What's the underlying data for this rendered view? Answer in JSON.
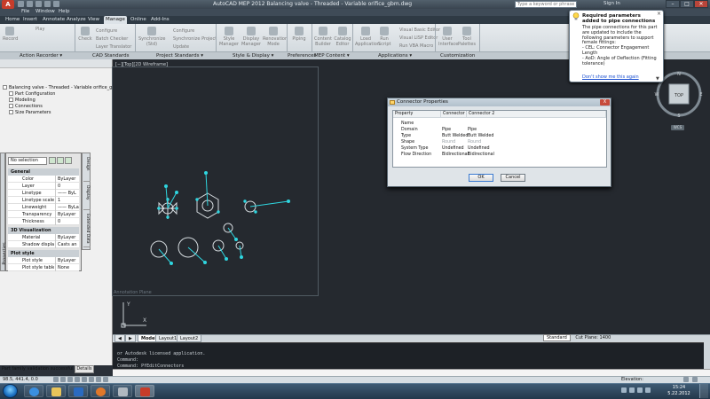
{
  "window": {
    "title": "AutoCAD MEP 2012   Balancing valve - Threaded - Variable orifice_gbm.dwg",
    "search_placeholder": "Type a keyword or phrase",
    "sign_in": "Sign In"
  },
  "menubar": [
    "File",
    "Window",
    "Help"
  ],
  "ribbon_tabs": [
    "Home",
    "Insert",
    "Annotate",
    "Analyze",
    "View",
    "Manage",
    "Online",
    "Add-Ins"
  ],
  "ribbon": {
    "buttons": [
      "Record",
      "Play",
      "Check",
      "Configure",
      "Batch Checker",
      "Layer Translator",
      "Synchronize (Std)",
      "Configure",
      "Synchronize Project",
      "Update",
      "Style Manager",
      "Display Manager",
      "Renovation Mode",
      "Piping",
      "Content Builder",
      "Catalog Editor",
      "Load Application",
      "Run Script",
      "Visual Basic Editor",
      "Visual LISP Editor",
      "Run VBA Macro",
      "User Interface",
      "Tool Palettes"
    ],
    "panels": [
      "Action Recorder ▾",
      "CAD Standards",
      "Project Standards ▾",
      "Style & Display ▾",
      "Preferences",
      "MEP Content ▾",
      "Applications ▾",
      "Customization"
    ]
  },
  "tree": {
    "root": "Balancing valve - Threaded - Variable orifice_gbm",
    "items": [
      "Part Configuration",
      "Modeling",
      "Connections",
      "Size Parameters"
    ]
  },
  "properties": {
    "selection": "No selection",
    "side_label": "Properties",
    "vtabs": [
      "Design",
      "Display",
      "Extended Data"
    ],
    "sections": [
      {
        "title": "General",
        "rows": [
          {
            "key": "Color",
            "value": "ByLayer"
          },
          {
            "key": "Layer",
            "value": "0"
          },
          {
            "key": "Linetype",
            "value": "—— ByL"
          },
          {
            "key": "Linetype scale",
            "value": "1"
          },
          {
            "key": "Lineweight",
            "value": "—— ByLa"
          },
          {
            "key": "Transparency",
            "value": "ByLayer"
          },
          {
            "key": "Thickness",
            "value": "0"
          }
        ]
      },
      {
        "title": "3D Visualization",
        "rows": [
          {
            "key": "Material",
            "value": "ByLayer"
          },
          {
            "key": "Shadow display",
            "value": "Casts an"
          }
        ]
      },
      {
        "title": "Plot style",
        "rows": [
          {
            "key": "Plot style",
            "value": "ByLayer"
          },
          {
            "key": "Plot style table",
            "value": "None"
          }
        ]
      }
    ]
  },
  "left_status": {
    "message": "Part family validation successful",
    "details": "Details"
  },
  "drawing": {
    "view_label": "[−][Top][2D Wireframe]",
    "annotation_label": "Annotation Plane",
    "ucs_x": "X",
    "ucs_y": "Y"
  },
  "viewcube": {
    "top": "TOP",
    "north": "N",
    "south": "S",
    "east": "E",
    "west": "W",
    "wcs": "WCS"
  },
  "notification": {
    "title": "Required parameters added to pipe connections",
    "body": "The pipe connections for this part are updated to include the following parameters to support female fittings:",
    "item1": "  - CEL: Connector Engagement Length",
    "item2": "  - AoD: Angle of Deflection (Fitting tolerance)",
    "link": "Don't show me this again"
  },
  "dialog": {
    "title": "Connector Properties",
    "close": "X",
    "columns": [
      "Property",
      "Connector 1",
      "Connector 2"
    ],
    "rows": [
      {
        "property": "Name",
        "c1": "",
        "c2": "",
        "gray": false
      },
      {
        "property": "Domain",
        "c1": "Pipe",
        "c2": "Pipe",
        "gray": false
      },
      {
        "property": "Type",
        "c1": "Butt Welded",
        "c2": "Butt Welded",
        "gray": false
      },
      {
        "property": "Shape",
        "c1": "Round",
        "c2": "Round",
        "gray": true
      },
      {
        "property": "System Type",
        "c1": "Undefined",
        "c2": "Undefined",
        "gray": false
      },
      {
        "property": "Flow Direction",
        "c1": "Bidirectional",
        "c2": "Bidirectional",
        "gray": false
      }
    ],
    "ok": "OK",
    "cancel": "Cancel"
  },
  "layout_tabs": [
    "Model",
    "Layout1",
    "Layout2"
  ],
  "annoscale": "Standard",
  "cut_plane": "Cut Plane:",
  "cut_plane_value": "1400",
  "command_lines": [
    "or Autodesk licensed application.",
    "Command:",
    "Command:  PfEditConnectors"
  ],
  "status": {
    "coords": "98.5,  441.4, 0.0",
    "elevation": "Elevation:"
  },
  "taskbar": {
    "time": "15:24",
    "date": "5.22.2012"
  },
  "colors": {
    "drawing_bg": "#25292f",
    "geometry": "#2fd6e0",
    "accent": "#3a7ad0"
  }
}
